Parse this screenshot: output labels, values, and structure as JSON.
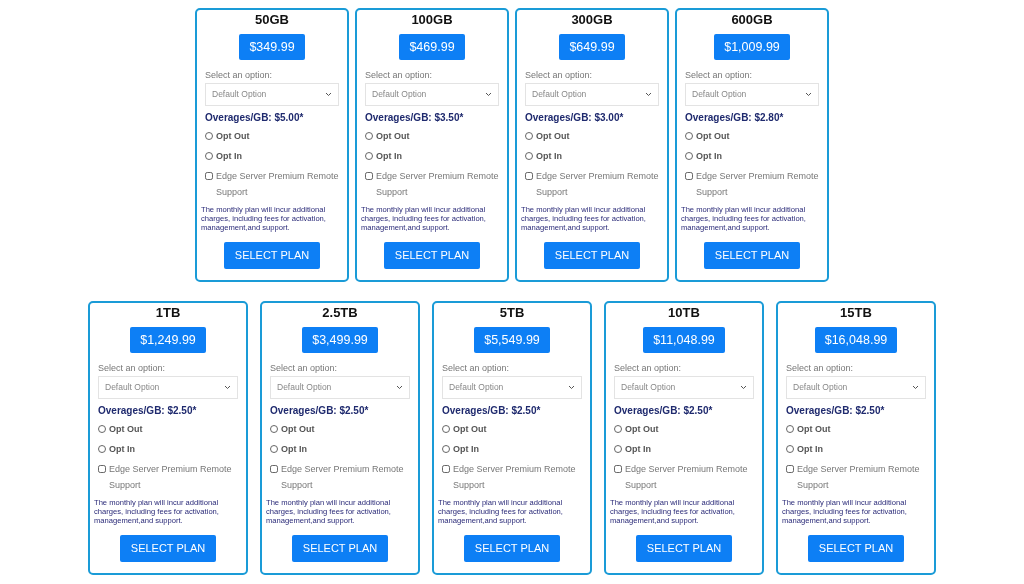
{
  "rows": [
    {
      "plans": [
        {
          "name": "50GB",
          "price": "$349.99",
          "select_label": "Select an option:",
          "select": {
            "placeholder": "Default Option"
          },
          "overages": "Overages/GB: $5.00*",
          "options": [
            {
              "label": "Opt Out",
              "kind": "radio",
              "checked": false
            },
            {
              "label": "Opt In",
              "kind": "radio",
              "checked": false
            },
            {
              "label": "Edge Server Premium Remote Support",
              "kind": "checkbox",
              "checked": false
            }
          ],
          "note": "The monthly plan will incur additional charges, including fees for activation, management,and support.",
          "button": "SELECT PLAN"
        },
        {
          "name": "100GB",
          "price": "$469.99",
          "select_label": "Select an option:",
          "select": {
            "placeholder": "Default Option"
          },
          "overages": "Overages/GB: $3.50*",
          "options": [
            {
              "label": "Opt Out",
              "kind": "radio",
              "checked": false
            },
            {
              "label": "Opt In",
              "kind": "radio",
              "checked": false
            },
            {
              "label": "Edge Server Premium Remote Support",
              "kind": "checkbox",
              "checked": false
            }
          ],
          "note": "The monthly plan will incur additional charges, including fees for activation, management,and support.",
          "button": "SELECT PLAN"
        },
        {
          "name": "300GB",
          "price": "$649.99",
          "select_label": "Select an option:",
          "select": {
            "placeholder": "Default Option"
          },
          "overages": "Overages/GB: $3.00*",
          "options": [
            {
              "label": "Opt Out",
              "kind": "radio",
              "checked": false
            },
            {
              "label": "Opt In",
              "kind": "radio",
              "checked": false
            },
            {
              "label": "Edge Server Premium Remote Support",
              "kind": "checkbox",
              "checked": false
            }
          ],
          "note": "The monthly plan will incur additional charges, including fees for activation, management,and support.",
          "button": "SELECT PLAN"
        },
        {
          "name": "600GB",
          "price": "$1,009.99",
          "select_label": "Select an option:",
          "select": {
            "placeholder": "Default Option"
          },
          "overages": "Overages/GB: $2.80*",
          "options": [
            {
              "label": "Opt Out",
              "kind": "radio",
              "checked": false
            },
            {
              "label": "Opt In",
              "kind": "radio",
              "checked": false
            },
            {
              "label": "Edge Server Premium Remote Support",
              "kind": "checkbox",
              "checked": false
            }
          ],
          "note": "The monthly plan will incur additional charges, including fees for activation, management,and support.",
          "button": "SELECT PLAN"
        }
      ]
    },
    {
      "plans": [
        {
          "name": "1TB",
          "price": "$1,249.99",
          "select_label": "Select an option:",
          "select": {
            "placeholder": "Default Option"
          },
          "overages": "Overages/GB: $2.50*",
          "options": [
            {
              "label": "Opt Out",
              "kind": "radio",
              "checked": false
            },
            {
              "label": "Opt In",
              "kind": "radio",
              "checked": false
            },
            {
              "label": "Edge Server Premium Remote Support",
              "kind": "checkbox",
              "checked": false
            }
          ],
          "note": "The monthly plan will incur additional charges, including fees for activation, management,and support.",
          "button": "SELECT PLAN"
        },
        {
          "name": "2.5TB",
          "price": "$3,499.99",
          "select_label": "Select an option:",
          "select": {
            "placeholder": "Default Option"
          },
          "overages": "Overages/GB: $2.50*",
          "options": [
            {
              "label": "Opt Out",
              "kind": "radio",
              "checked": false
            },
            {
              "label": "Opt In",
              "kind": "radio",
              "checked": false
            },
            {
              "label": "Edge Server Premium Remote Support",
              "kind": "checkbox",
              "checked": false
            }
          ],
          "note": "The monthly plan will incur additional charges, including fees for activation, management,and support.",
          "button": "SELECT PLAN"
        },
        {
          "name": "5TB",
          "price": "$5,549.99",
          "select_label": "Select an option:",
          "select": {
            "placeholder": "Default Option"
          },
          "overages": "Overages/GB: $2.50*",
          "options": [
            {
              "label": "Opt Out",
              "kind": "radio",
              "checked": false
            },
            {
              "label": "Opt In",
              "kind": "radio",
              "checked": false
            },
            {
              "label": "Edge Server Premium Remote Support",
              "kind": "checkbox",
              "checked": false
            }
          ],
          "note": "The monthly plan will incur additional charges, including fees for activation, management,and support.",
          "button": "SELECT PLAN"
        },
        {
          "name": "10TB",
          "price": "$11,048.99",
          "select_label": "Select an option:",
          "select": {
            "placeholder": "Default Option"
          },
          "overages": "Overages/GB: $2.50*",
          "options": [
            {
              "label": "Opt Out",
              "kind": "radio",
              "checked": false
            },
            {
              "label": "Opt In",
              "kind": "radio",
              "checked": false
            },
            {
              "label": "Edge Server Premium Remote Support",
              "kind": "checkbox",
              "checked": false
            }
          ],
          "note": "The monthly plan will incur additional charges, including fees for activation, management,and support.",
          "button": "SELECT PLAN"
        },
        {
          "name": "15TB",
          "price": "$16,048.99",
          "select_label": "Select an option:",
          "select": {
            "placeholder": "Default Option"
          },
          "overages": "Overages/GB: $2.50*",
          "options": [
            {
              "label": "Opt Out",
              "kind": "radio",
              "checked": false
            },
            {
              "label": "Opt In",
              "kind": "radio",
              "checked": false
            },
            {
              "label": "Edge Server Premium Remote Support",
              "kind": "checkbox",
              "checked": false
            }
          ],
          "note": "The monthly plan will incur additional charges, including fees for activation, management,and support.",
          "button": "SELECT PLAN"
        }
      ]
    }
  ]
}
